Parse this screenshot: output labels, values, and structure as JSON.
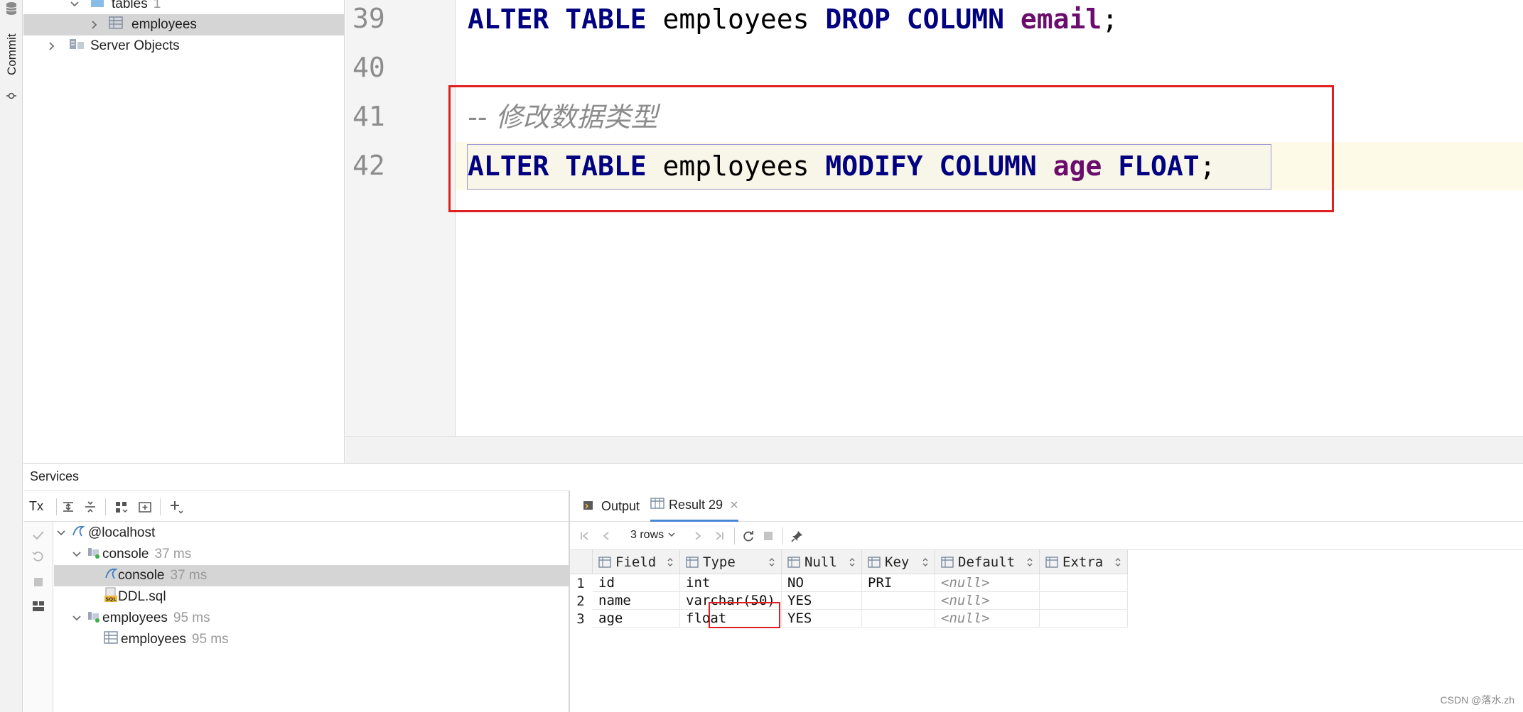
{
  "sidebar_strip": {
    "commit_label": "Commit"
  },
  "db_tree": {
    "tables_label": "tables",
    "tables_count": "1",
    "employees_label": "employees",
    "server_objects_label": "Server Objects"
  },
  "editor": {
    "lines": [
      {
        "num": "39",
        "tokens": [
          {
            "t": "ALTER",
            "c": "kw"
          },
          {
            "t": " ",
            "c": "ident"
          },
          {
            "t": "TABLE",
            "c": "kw"
          },
          {
            "t": " employees ",
            "c": "ident"
          },
          {
            "t": "DROP",
            "c": "kw"
          },
          {
            "t": " ",
            "c": "ident"
          },
          {
            "t": "COLUMN",
            "c": "kw"
          },
          {
            "t": " ",
            "c": "ident"
          },
          {
            "t": "email",
            "c": "col"
          },
          {
            "t": ";",
            "c": "ident"
          }
        ]
      },
      {
        "num": "40",
        "tokens": []
      },
      {
        "num": "41",
        "tokens": [
          {
            "t": "-- 修改数据类型",
            "c": "cmt"
          }
        ]
      },
      {
        "num": "42",
        "tokens": [
          {
            "t": "ALTER",
            "c": "kw"
          },
          {
            "t": " ",
            "c": "ident"
          },
          {
            "t": "TABLE",
            "c": "kw"
          },
          {
            "t": " employees ",
            "c": "ident"
          },
          {
            "t": "MODIFY",
            "c": "kw"
          },
          {
            "t": " ",
            "c": "ident"
          },
          {
            "t": "COLUMN",
            "c": "kw"
          },
          {
            "t": " ",
            "c": "ident"
          },
          {
            "t": "age",
            "c": "col"
          },
          {
            "t": " ",
            "c": "ident"
          },
          {
            "t": "FLOAT",
            "c": "kw"
          },
          {
            "t": ";",
            "c": "ident"
          }
        ]
      }
    ]
  },
  "services": {
    "title": "Services",
    "tx_label": "Tx",
    "tree": [
      {
        "label": "@localhost",
        "ms": ""
      },
      {
        "label": "console",
        "ms": "37 ms"
      },
      {
        "label": "console",
        "ms": "37 ms"
      },
      {
        "label": "DDL.sql",
        "ms": ""
      },
      {
        "label": "employees",
        "ms": "95 ms"
      },
      {
        "label": "employees",
        "ms": "95 ms"
      }
    ]
  },
  "result": {
    "tab_output": "Output",
    "tab_result": "Result 29",
    "rows_label": "3 rows",
    "columns": [
      "Field",
      "Type",
      "Null",
      "Key",
      "Default",
      "Extra"
    ],
    "rows": [
      {
        "num": "1",
        "cells": [
          "id",
          "int",
          "NO",
          "PRI",
          "<null>",
          ""
        ]
      },
      {
        "num": "2",
        "cells": [
          "name",
          "varchar(50)",
          "YES",
          "",
          "<null>",
          ""
        ]
      },
      {
        "num": "3",
        "cells": [
          "age",
          "float",
          "YES",
          "",
          "<null>",
          ""
        ]
      }
    ]
  },
  "watermark": "CSDN @落水.zh",
  "colors": {
    "keyword": "#000080",
    "column": "#6b0d6b",
    "comment": "#8c8c8c",
    "highlight_red": "#e02020",
    "tab_accent": "#4a86d8"
  }
}
